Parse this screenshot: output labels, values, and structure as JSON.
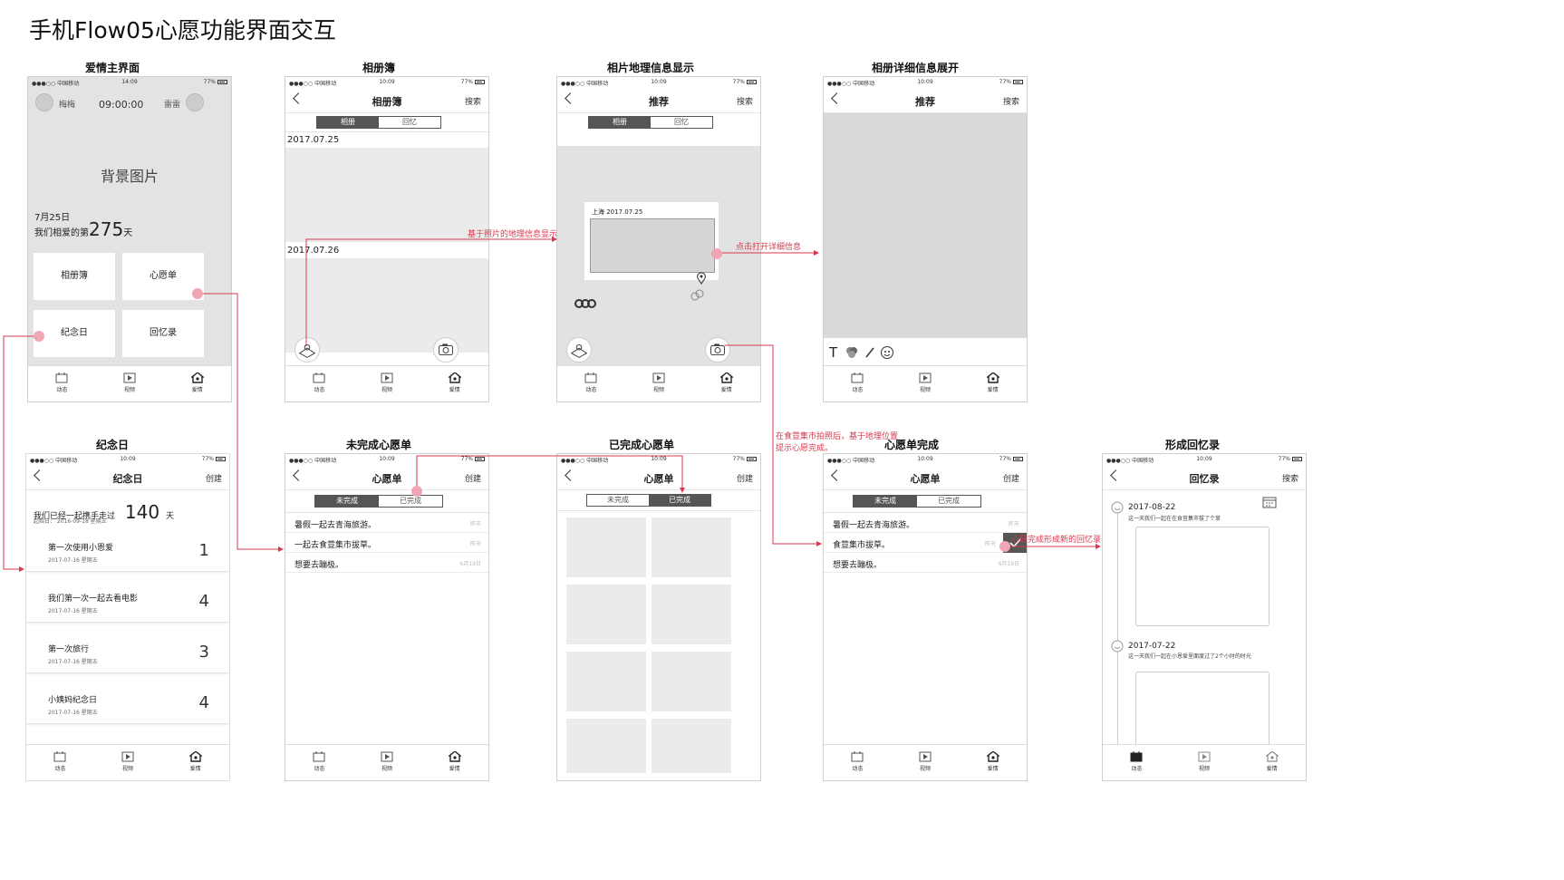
{
  "doc_title": "手机Flow05心愿功能界面交互",
  "colors": {
    "accent": "#d8384d",
    "dot": "#f1a6b6",
    "placeholder": "#d9d9d9"
  },
  "status": {
    "carrier": "●●●○○ 中国移动",
    "battery": "77%",
    "time_a": "14:09",
    "time_b": "10:09"
  },
  "tabbar": {
    "tab1": "动态",
    "tab2": "视频",
    "tab3": "爱情"
  },
  "screens": {
    "love_home": {
      "title": "爱情主界面",
      "user_left": "梅梅",
      "user_right": "雷雷",
      "clock": "09:00:00",
      "bg_label": "背景图片",
      "date": "7月25日",
      "days_prefix": "我们相爱的第",
      "days_num": "275",
      "days_suffix": "天",
      "btn_album": "相册簿",
      "btn_wish": "心愿单",
      "btn_anniv": "纪念日",
      "btn_memo": "回忆录"
    },
    "album": {
      "title": "相册簿",
      "nav_title": "相册簿",
      "nav_action": "搜索",
      "seg_on": "相册",
      "seg_off": "回忆",
      "date1": "2017.07.25",
      "date2": "2017.07.26"
    },
    "geo": {
      "title": "相片地理信息显示",
      "nav_title": "推荐",
      "nav_action": "搜索",
      "seg_on": "相册",
      "seg_off": "回忆",
      "card_caption": "上海  2017.07.25"
    },
    "detail": {
      "title": "相册详细信息展开",
      "nav_title": "推荐",
      "nav_action": "搜索",
      "tool_text": "T"
    },
    "anniversary": {
      "title": "纪念日",
      "nav_title": "纪念日",
      "nav_action": "创建",
      "headline": "我们已经一起携手走过",
      "count": "140",
      "unit": "天",
      "start": "起始日：  2016-09-18 星期五",
      "items": [
        {
          "title": "第一次使用小恩爱",
          "date": "2017-07-16 星期五",
          "num": "1"
        },
        {
          "title": "我们第一次一起去看电影",
          "date": "2017-07-16 星期五",
          "num": "4"
        },
        {
          "title": "第一次旅行",
          "date": "2017-07-16 星期五",
          "num": "3"
        },
        {
          "title": "小姨妈纪念日",
          "date": "2017-07-16 星期五",
          "num": "4"
        }
      ]
    },
    "wish_undone": {
      "title": "未完成心愿单",
      "nav_title": "心愿单",
      "nav_action": "创建",
      "seg_on": "未完成",
      "seg_off": "已完成",
      "items": [
        {
          "text": "暑假一起去青海旅游。",
          "date": "昨天"
        },
        {
          "text": "一起去食荳集市拔草。",
          "date": "昨天"
        },
        {
          "text": "想要去蹦极。",
          "date": "6月19日"
        }
      ]
    },
    "wish_done": {
      "title": "已完成心愿单",
      "nav_title": "心愿单",
      "nav_action": "创建",
      "seg_off": "未完成",
      "seg_on": "已完成"
    },
    "wish_complete": {
      "title": "心愿单完成",
      "nav_title": "心愿单",
      "nav_action": "创建",
      "seg_on": "未完成",
      "seg_off": "已完成",
      "items": [
        {
          "text": "暑假一起去青海旅游。",
          "date": "昨天"
        },
        {
          "text": "食荳集市拔草。",
          "date": "昨天"
        },
        {
          "text": "想要去蹦极。",
          "date": "6月19日"
        }
      ]
    },
    "memoir": {
      "title": "形成回忆录",
      "nav_title": "回忆录",
      "nav_action": "搜索",
      "entry1_date": "2017-08-22",
      "entry1_text": "这一天我们一起在在食荳集市拔了个草",
      "entry2_date": "2017-07-22",
      "entry2_text": "这一天我们一起在小恩爱里面度过了2个小时的时光"
    }
  },
  "notes": {
    "geo": "基于照片的地理信息显示",
    "detail": "点击打开详细信息",
    "market": "在食荳集市拍照后，基于地理位置提示心愿完成。",
    "memoir": "心愿完成形成新的回忆录"
  }
}
